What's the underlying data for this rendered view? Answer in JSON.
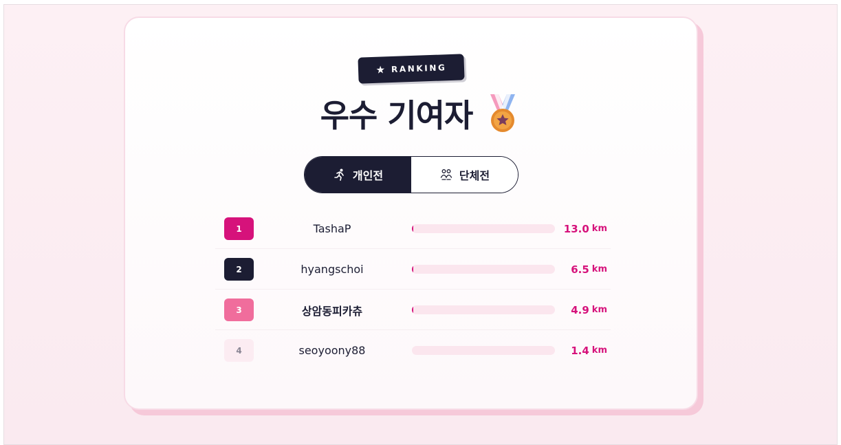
{
  "badge": {
    "label": "RANKING",
    "icon": "star-icon"
  },
  "title": {
    "text": "우수 기여자",
    "icon": "medal-icon"
  },
  "tabs": [
    {
      "label": "개인전",
      "icon": "running-person-icon",
      "active": true
    },
    {
      "label": "단체전",
      "icon": "group-icon",
      "active": false
    }
  ],
  "colors": {
    "dark": "#1c1d33",
    "accent": "#d6127b",
    "rank1": "#d6127b",
    "rank2": "#1c1d33",
    "rank3": "#f06d9c",
    "rank4": "#fcecf2",
    "track": "#fbe6ee"
  },
  "ranking": [
    {
      "rank": "1",
      "name": "TashaP",
      "distance": "13.0",
      "unit": "km",
      "progress": 0.01
    },
    {
      "rank": "2",
      "name": "hyangschoi",
      "distance": "6.5",
      "unit": "km",
      "progress": 0.005
    },
    {
      "rank": "3",
      "name": "상암동피카츄",
      "distance": "4.9",
      "unit": "km",
      "progress": 0.004
    },
    {
      "rank": "4",
      "name": "seoyoony88",
      "distance": "1.4",
      "unit": "km",
      "progress": 0.0
    }
  ]
}
